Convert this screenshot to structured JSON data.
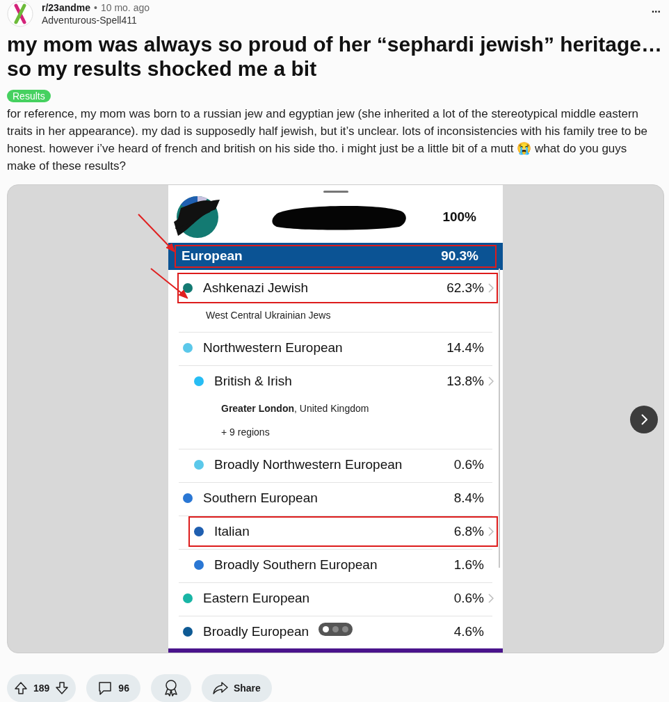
{
  "post": {
    "subreddit": "r/23andme",
    "separator": "•",
    "age": "10 mo. ago",
    "author": "Adventurous-Spell411",
    "more": "...",
    "title": "my mom was always so proud of her “sephardi jewish” heritage… so my results shocked me a bit",
    "flair": "Results",
    "body": "for reference, my mom was born to a russian jew and egyptian jew (she inherited a lot of the stereotypical middle eastern traits in her appearance). my dad is supposedly half jewish, but it’s unclear. lots of inconsistencies with his family tree to be honest. however i’ve heard of french and british on his side tho. i might just be a little bit of a mutt 😭 what do you guys make of these results?"
  },
  "screenshot": {
    "total": "100%",
    "region": {
      "name": "European",
      "percent": "90.3%",
      "highlighted": true
    },
    "rows": [
      {
        "name": "Ashkenazi Jewish",
        "percent": "62.3%",
        "color": "#137a72",
        "chevron": true,
        "highlighted": true,
        "details": [
          "West Central Ukrainian Jews"
        ]
      },
      {
        "name": "Northwestern European",
        "percent": "14.4%",
        "color": "#5bc8ea",
        "chevron": false,
        "highlighted": false,
        "children": [
          {
            "name": "British & Irish",
            "percent": "13.8%",
            "color": "#27bdf4",
            "chevron": true,
            "highlighted": false,
            "details": [
              "**Greater London**, United Kingdom",
              "+ 9 regions"
            ]
          },
          {
            "name": "Broadly Northwestern European",
            "percent": "0.6%",
            "color": "#5bc8ea",
            "chevron": false,
            "highlighted": false
          }
        ]
      },
      {
        "name": "Southern European",
        "percent": "8.4%",
        "color": "#2a77d4",
        "chevron": false,
        "highlighted": false,
        "children": [
          {
            "name": "Italian",
            "percent": "6.8%",
            "color": "#1f5fb0",
            "chevron": true,
            "highlighted": true
          },
          {
            "name": "Broadly Southern European",
            "percent": "1.6%",
            "color": "#2a77d4",
            "chevron": false,
            "highlighted": false
          }
        ]
      },
      {
        "name": "Eastern European",
        "percent": "0.6%",
        "color": "#19b5a5",
        "chevron": true,
        "highlighted": false
      },
      {
        "name": "Broadly European",
        "percent": "4.6%",
        "color": "#0e5a94",
        "chevron": false,
        "highlighted": false
      }
    ]
  },
  "carousel": {
    "pages": [
      {
        "selected": true
      },
      {
        "selected": false
      },
      {
        "selected": false
      }
    ]
  },
  "actions": {
    "votes": "189",
    "comments": "96",
    "share": "Share"
  }
}
